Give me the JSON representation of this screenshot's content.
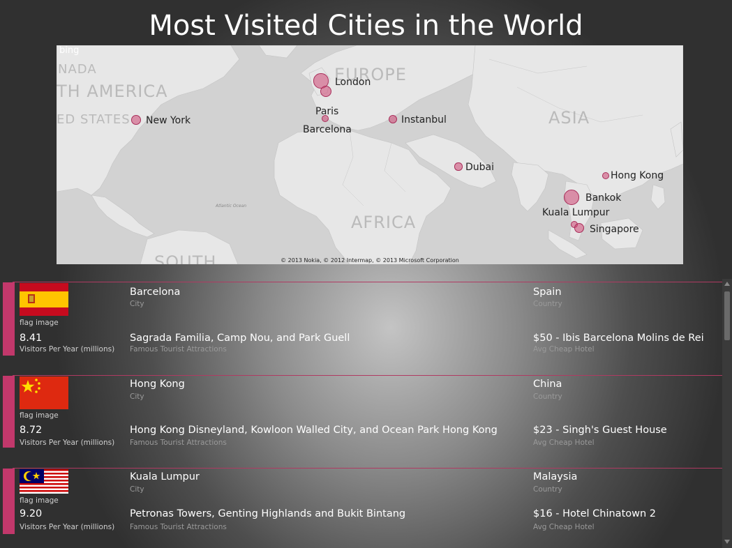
{
  "title": "Most Visited Cities in the World",
  "map": {
    "provider": "bing",
    "copyright": "© 2013 Nokia, © 2012 Intermap, © 2013 Microsoft Corporation",
    "regions": [
      "EUROPE",
      "TH AMERICA",
      "ASIA",
      "AFRICA",
      "NADA",
      "ED STATES",
      "SOUTH"
    ],
    "ocean": "Atlantic Ocean",
    "bubble_color": "#cd4673",
    "cities": [
      {
        "name": "London",
        "visitors": 16.0
      },
      {
        "name": "Paris",
        "visitors": 13.0
      },
      {
        "name": "Barcelona",
        "visitors": 8.41
      },
      {
        "name": "New York",
        "visitors": 11.0
      },
      {
        "name": "Instanbul",
        "visitors": 10.5
      },
      {
        "name": "Dubai",
        "visitors": 9.5
      },
      {
        "name": "Hong Kong",
        "visitors": 8.72
      },
      {
        "name": "Bankok",
        "visitors": 16.5
      },
      {
        "name": "Kuala Lumpur",
        "visitors": 9.2
      },
      {
        "name": "Singapore",
        "visitors": 11.5
      }
    ]
  },
  "field_labels": {
    "flag": "flag image",
    "visitors": "Visitors Per Year (millions)",
    "city": "City",
    "attractions": "Famous Tourist Attractions",
    "country": "Country",
    "hotel": "Avg Cheap Hotel"
  },
  "cards": [
    {
      "city": "Barcelona",
      "country": "Spain",
      "visitors": "8.41",
      "attractions": "Sagrada Familia, Camp Nou, and Park Guell",
      "hotel": "$50 - Ibis Barcelona Molins de Rei",
      "flag": "spain-flag"
    },
    {
      "city": "Hong Kong",
      "country": "China",
      "visitors": "8.72",
      "attractions": "Hong Kong Disneyland, Kowloon Walled City, and Ocean Park Hong Kong",
      "hotel": "$23 - Singh's Guest House",
      "flag": "china-flag"
    },
    {
      "city": "Kuala Lumpur",
      "country": "Malaysia",
      "visitors": "9.20",
      "attractions": "Petronas Towers, Genting Highlands and Bukit Bintang",
      "hotel": "$16 - Hotel Chinatown 2",
      "flag": "malaysia-flag"
    }
  ]
}
